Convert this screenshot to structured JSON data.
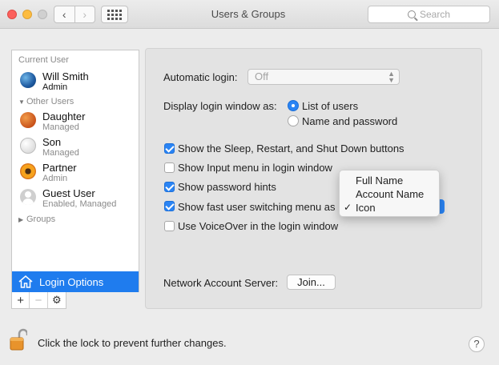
{
  "window": {
    "title": "Users & Groups"
  },
  "toolbar": {
    "back_icon": "chevron-left-icon",
    "forward_icon": "chevron-right-icon",
    "show_all_icon": "grid-icon",
    "search_placeholder": "Search"
  },
  "sidebar": {
    "current_user_header": "Current User",
    "current_user": {
      "name": "Will Smith",
      "role": "Admin",
      "avatar": "earth-icon"
    },
    "other_users_header": "Other Users",
    "other_users": [
      {
        "name": "Daughter",
        "role": "Managed",
        "avatar": "basketball-icon"
      },
      {
        "name": "Son",
        "role": "Managed",
        "avatar": "baseball-icon"
      },
      {
        "name": "Partner",
        "role": "Admin",
        "avatar": "flower-icon"
      },
      {
        "name": "Guest User",
        "role": "Enabled, Managed",
        "avatar": "guest-icon"
      }
    ],
    "groups_label": "Groups",
    "login_options_label": "Login Options",
    "add_icon": "plus-icon",
    "remove_icon": "minus-icon",
    "action_icon": "gear-icon"
  },
  "main": {
    "automatic_login_label": "Automatic login:",
    "automatic_login_value": "Off",
    "display_login_label": "Display login window as:",
    "display_options": [
      {
        "label": "List of users",
        "selected": true
      },
      {
        "label": "Name and password",
        "selected": false
      }
    ],
    "checkboxes": [
      {
        "label": "Show the Sleep, Restart, and Shut Down buttons",
        "checked": true
      },
      {
        "label": "Show Input menu in login window",
        "checked": false
      },
      {
        "label": "Show password hints",
        "checked": true
      },
      {
        "label": "Show fast user switching menu as",
        "checked": true
      },
      {
        "label": "Use VoiceOver in the login window",
        "checked": false
      }
    ],
    "switching_menu_options": [
      {
        "label": "Full Name",
        "selected": false
      },
      {
        "label": "Account Name",
        "selected": false
      },
      {
        "label": "Icon",
        "selected": true
      }
    ],
    "check_glyph": "✓",
    "network_server_label": "Network Account Server:",
    "join_button": "Join..."
  },
  "footer": {
    "lock_text": "Click the lock to prevent further changes.",
    "help_label": "?"
  },
  "colors": {
    "accent": "#2a84f4",
    "selection": "#1f7cee"
  }
}
